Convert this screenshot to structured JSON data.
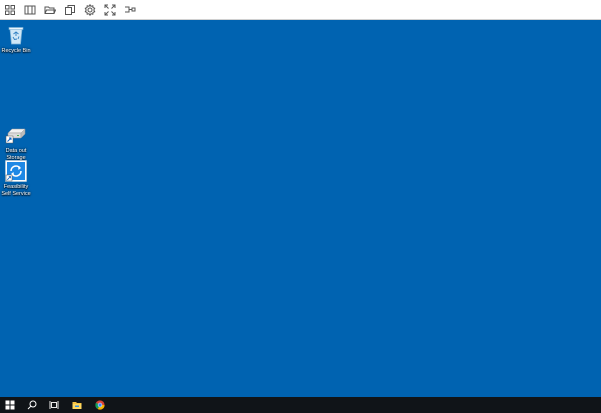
{
  "toolbar": {
    "buttons": [
      {
        "name": "apps-grid-icon"
      },
      {
        "name": "split-view-icon"
      },
      {
        "name": "folder-open-icon"
      },
      {
        "name": "copy-icon"
      },
      {
        "name": "gear-icon"
      },
      {
        "name": "fullscreen-icon"
      },
      {
        "name": "disconnect-icon"
      }
    ]
  },
  "desktop": {
    "background_color": "#0063b1",
    "icons": [
      {
        "label": "Recycle Bin"
      },
      {
        "label": "Data out\nStorage"
      },
      {
        "label": "Feasibility\nSelf Service"
      }
    ]
  },
  "taskbar": {
    "background_color": "#101418",
    "items": [
      {
        "name": "start-icon"
      },
      {
        "name": "search-icon"
      },
      {
        "name": "task-view-icon"
      },
      {
        "name": "file-explorer-icon"
      },
      {
        "name": "chrome-icon"
      }
    ]
  }
}
